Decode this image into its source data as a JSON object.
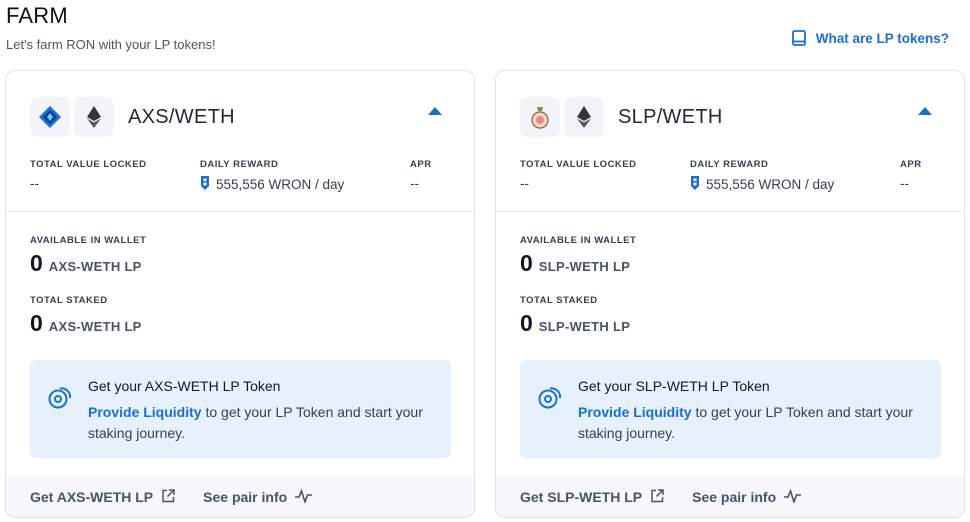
{
  "page": {
    "title": "FARM",
    "subtitle": "Let's farm RON with your LP tokens!",
    "lp_link_label": "What are LP tokens?"
  },
  "colors": {
    "accent": "#1b6fd0",
    "info_bg": "#e6f1fc",
    "footer_bg": "#f5f7fa"
  },
  "farms": [
    {
      "pair_name": "AXS/WETH",
      "icons": [
        "axs-token-icon",
        "eth-token-icon"
      ],
      "stats": {
        "tvl_label": "TOTAL VALUE LOCKED",
        "tvl_value": "--",
        "reward_label": "DAILY REWARD",
        "reward_value": "555,556 WRON / day",
        "apr_label": "APR",
        "apr_value": "--"
      },
      "wallet": {
        "label": "AVAILABLE IN WALLET",
        "amount": "0",
        "unit": "AXS-WETH LP"
      },
      "staked": {
        "label": "TOTAL STAKED",
        "amount": "0",
        "unit": "AXS-WETH LP"
      },
      "info": {
        "title": "Get your AXS-WETH LP Token",
        "link": "Provide Liquidity",
        "text": " to get your LP Token and start your staking journey."
      },
      "footer": {
        "get_lp": "Get AXS-WETH LP",
        "pair_info": "See pair info"
      }
    },
    {
      "pair_name": "SLP/WETH",
      "icons": [
        "slp-token-icon",
        "eth-token-icon"
      ],
      "stats": {
        "tvl_label": "TOTAL VALUE LOCKED",
        "tvl_value": "--",
        "reward_label": "DAILY REWARD",
        "reward_value": "555,556 WRON / day",
        "apr_label": "APR",
        "apr_value": "--"
      },
      "wallet": {
        "label": "AVAILABLE IN WALLET",
        "amount": "0",
        "unit": "SLP-WETH LP"
      },
      "staked": {
        "label": "TOTAL STAKED",
        "amount": "0",
        "unit": "SLP-WETH LP"
      },
      "info": {
        "title": "Get your SLP-WETH LP Token",
        "link": "Provide Liquidity",
        "text": " to get your LP Token and start your staking journey."
      },
      "footer": {
        "get_lp": "Get SLP-WETH LP",
        "pair_info": "See pair info"
      }
    }
  ]
}
